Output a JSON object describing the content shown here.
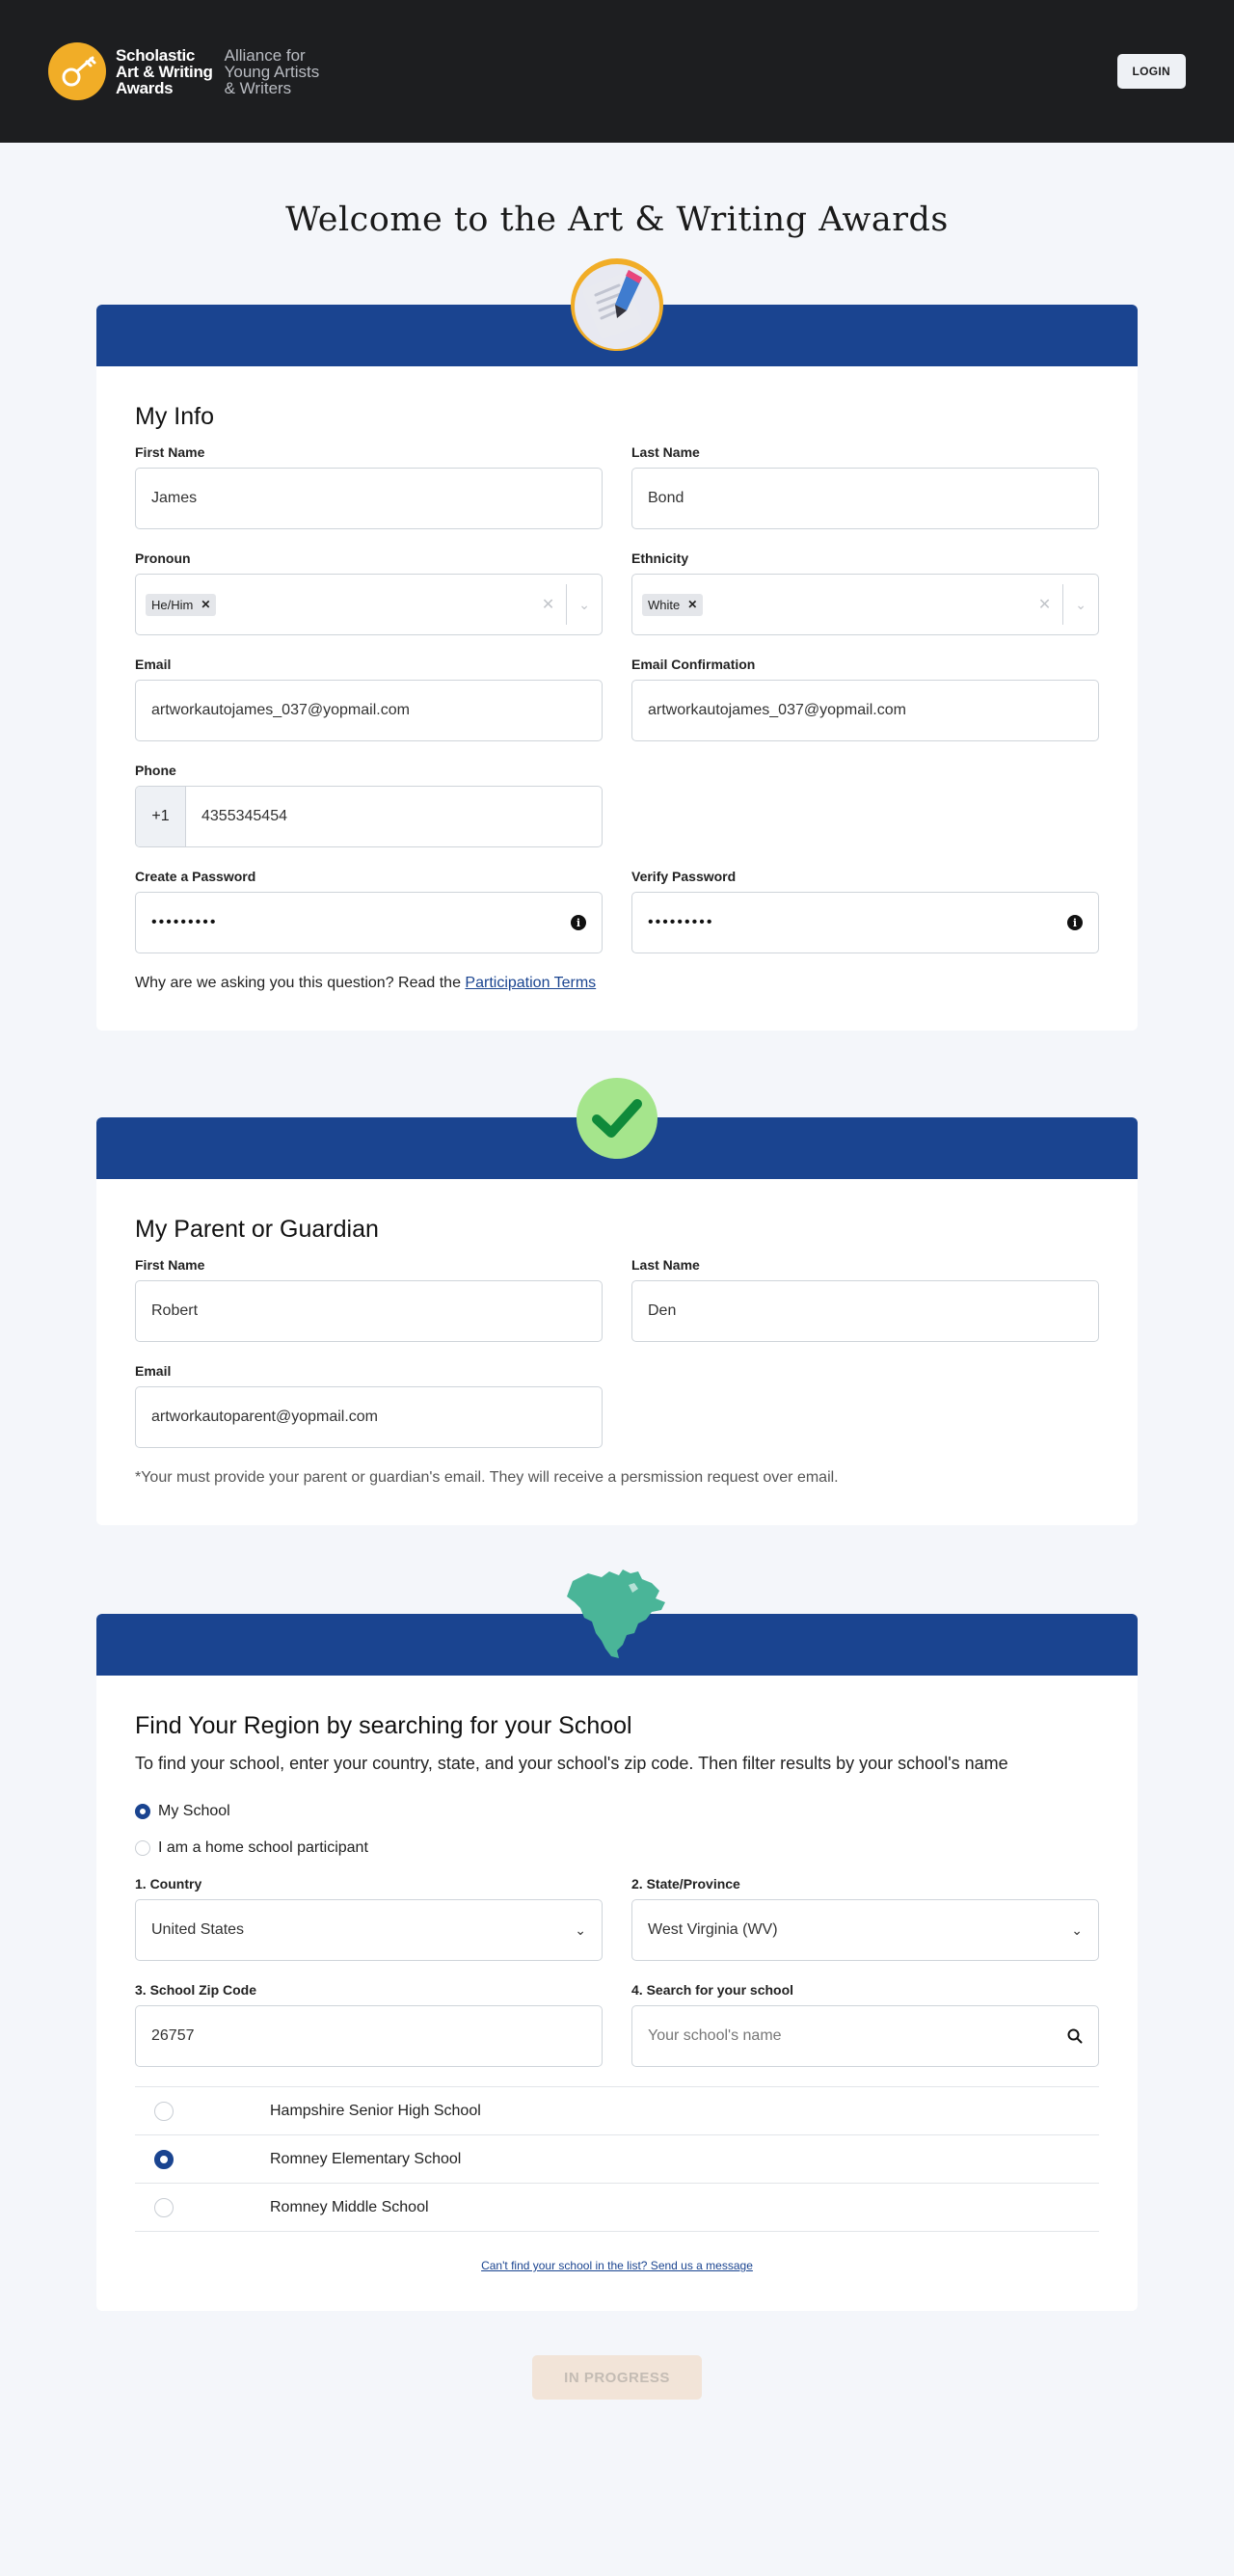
{
  "header": {
    "logo_line1": "Scholastic",
    "logo_line2": "Art & Writing",
    "logo_line3": "Awards",
    "alliance_line1": "Alliance for",
    "alliance_line2": "Young Artists",
    "alliance_line3": "& Writers",
    "login_label": "LOGIN"
  },
  "page_title": "Welcome to the Art & Writing Awards",
  "my_info": {
    "heading": "My Info",
    "first_name_label": "First Name",
    "first_name_value": "James",
    "last_name_label": "Last Name",
    "last_name_value": "Bond",
    "pronoun_label": "Pronoun",
    "pronoun_tag": "He/Him",
    "ethnicity_label": "Ethnicity",
    "ethnicity_tag": "White",
    "email_label": "Email",
    "email_value": "artworkautojames_037@yopmail.com",
    "email_confirm_label": "Email Confirmation",
    "email_confirm_value": "artworkautojames_037@yopmail.com",
    "phone_label": "Phone",
    "phone_country_code": "+1",
    "phone_value": "4355345454",
    "password_label": "Create a Password",
    "password_value": "•••••••••",
    "verify_password_label": "Verify Password",
    "verify_password_value": "•••••••••",
    "why_text": "Why are we asking you this question? Read the",
    "terms_link": "Participation Terms"
  },
  "guardian": {
    "heading": "My Parent or Guardian",
    "first_name_label": "First Name",
    "first_name_value": "Robert",
    "last_name_label": "Last Name",
    "last_name_value": "Den",
    "email_label": "Email",
    "email_value": "artworkautoparent@yopmail.com",
    "note": "*Your must provide your parent or guardian's email. They will receive a persmission request over email."
  },
  "region": {
    "heading": "Find Your Region by searching for your School",
    "description": "To find your school, enter your country, state, and your school's zip code. Then filter results by your school's name",
    "option_school": "My School",
    "option_home": "I am a home school participant",
    "selected_option": "My School",
    "country_label": "1. Country",
    "country_value": "United States",
    "state_label": "2. State/Province",
    "state_value": "West Virginia (WV)",
    "zip_label": "3. School Zip Code",
    "zip_value": "26757",
    "search_label": "4. Search for your school",
    "search_placeholder": "Your school's name",
    "schools": [
      {
        "name": "Hampshire Senior High School",
        "selected": false
      },
      {
        "name": "Romney Elementary School",
        "selected": true
      },
      {
        "name": "Romney Middle School",
        "selected": false
      }
    ],
    "help_link": "Can't find your school in the list? Send us a message"
  },
  "submit_label": "IN PROGRESS",
  "colors": {
    "brand_blue": "#1a4490",
    "header_bg": "#1d1e20",
    "logo_orange": "#f1ad27",
    "check_green": "#a5e58c",
    "map_teal": "#4ab598"
  }
}
